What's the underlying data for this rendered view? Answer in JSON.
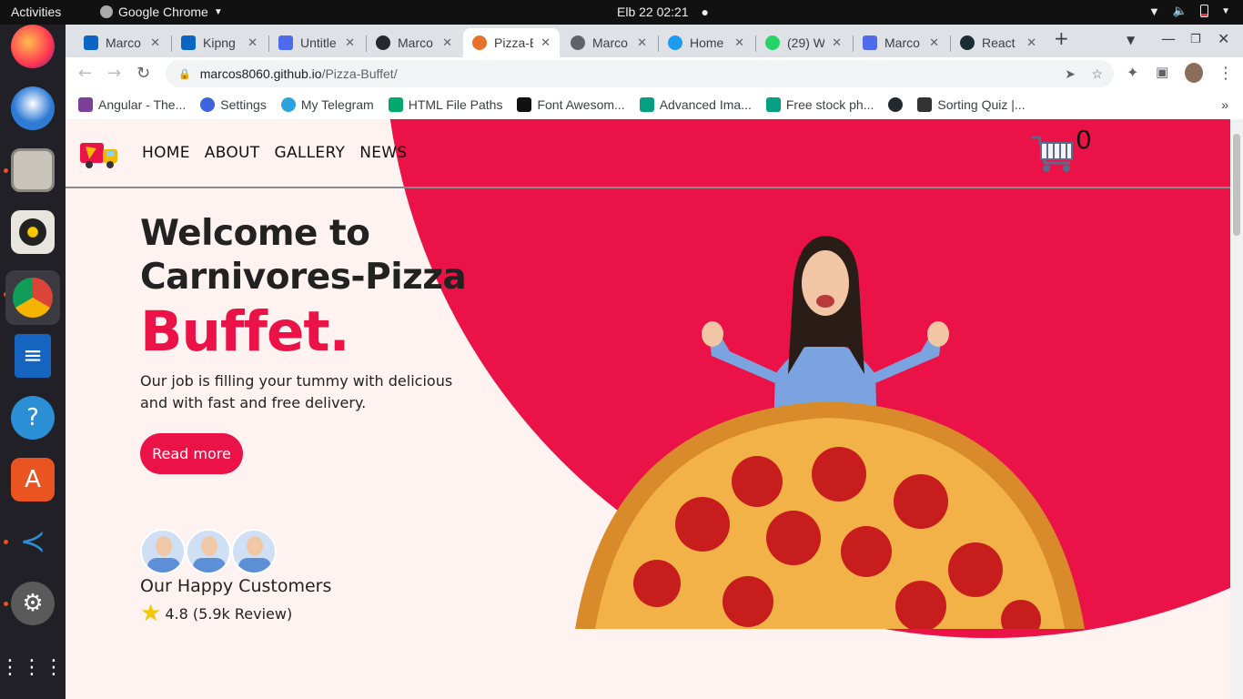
{
  "system": {
    "activities": "Activities",
    "app_name": "Google Chrome",
    "clock": "Elb 22  02:21"
  },
  "tabs": [
    {
      "label": "Marco",
      "icon": "linkedin-icon",
      "color": "#0a66c2"
    },
    {
      "label": "Kipng",
      "icon": "linkedin-icon",
      "color": "#0a66c2"
    },
    {
      "label": "Untitle",
      "icon": "docs-icon",
      "color": "#4f6bed"
    },
    {
      "label": "Marco",
      "icon": "github-icon",
      "color": "#24292e"
    },
    {
      "label": "Pizza-B",
      "icon": "pizza-icon",
      "color": "#e8712a",
      "active": true
    },
    {
      "label": "Marco",
      "icon": "globe-icon",
      "color": "#5f6368"
    },
    {
      "label": "Home",
      "icon": "twitter-icon",
      "color": "#1d9bf0"
    },
    {
      "label": "(29) W",
      "icon": "whatsapp-icon",
      "color": "#25d366"
    },
    {
      "label": "Marco",
      "icon": "docs-icon",
      "color": "#4f6bed"
    },
    {
      "label": "React",
      "icon": "react-icon",
      "color": "#1b2b34"
    }
  ],
  "address": {
    "host": "marcos8060.github.io",
    "path": "/Pizza-Buffet/"
  },
  "bookmarks": [
    {
      "label": "Angular - The...",
      "color": "#7b3f98"
    },
    {
      "label": "Settings",
      "color": "#3d63dd"
    },
    {
      "label": "My Telegram",
      "color": "#2aa3df"
    },
    {
      "label": "HTML File Paths",
      "color": "#04aa6d"
    },
    {
      "label": "Font Awesom...",
      "color": "#111111"
    },
    {
      "label": "Advanced Ima...",
      "color": "#05a081"
    },
    {
      "label": "Free stock ph...",
      "color": "#05a081"
    },
    {
      "label": "",
      "color": "#24292e"
    },
    {
      "label": "Sorting Quiz |...",
      "color": "#333333"
    }
  ],
  "page": {
    "nav": [
      "HOME",
      "ABOUT",
      "GALLERY",
      "NEWS"
    ],
    "cart_count": "0",
    "hero_line1": "Welcome to",
    "hero_line2": "Carnivores-Pizza",
    "hero_accent": "Buffet.",
    "hero_desc": "Our job is filling your tummy with delicious and with fast and free delivery.",
    "read_more": "Read more",
    "customers_label": "Our Happy Customers",
    "rating": "4.8 (5.9k Review)",
    "brand_red": "#ea1246"
  }
}
